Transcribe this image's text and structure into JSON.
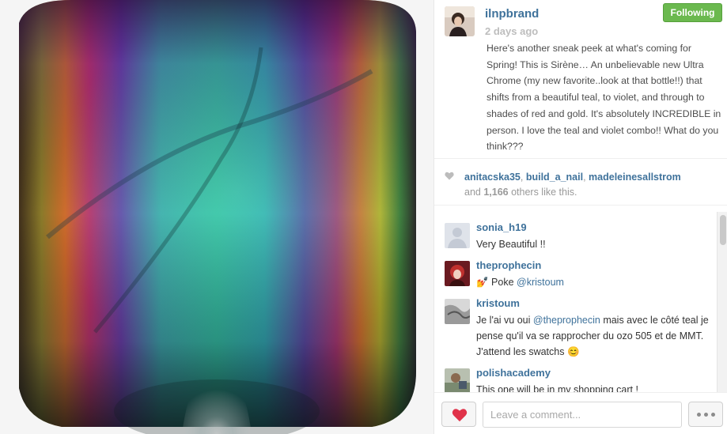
{
  "photo": {
    "subject": "nail polish bottle with multichrome polish",
    "colors": [
      "#2ea5a0",
      "#6a3d9a",
      "#c93a6a",
      "#e8a23a",
      "#2d8f5c"
    ]
  },
  "post": {
    "username": "ilnpbrand",
    "time": "2 days ago",
    "follow_label": "Following",
    "caption": "Here's another sneak peek at what's coming for Spring! This is Sirène… An unbelievable new Ultra Chrome (my new favorite..look at that bottle!!) that shifts from a beautiful teal, to violet, and through to shades of red and gold. It's absolutely INCREDIBLE in person. I love the teal and violet combo!! What do you think???"
  },
  "likes": {
    "users": [
      "anitacska35",
      "build_a_nail",
      "madeleinesallstrom"
    ],
    "sep1": ", ",
    "sep2": ", ",
    "and": "and ",
    "count": "1,166",
    "suffix": " others like this."
  },
  "comments": [
    {
      "user": "sonia_h19",
      "text": "Very Beautiful !!"
    },
    {
      "user": "theprophecin",
      "text": "💅 Poke ",
      "mention": "@kristoum"
    },
    {
      "user": "kristoum",
      "text_before": "Je l'ai vu oui ",
      "mention": "@theprophecin",
      "text_after": " mais avec le côté teal je pense qu'il va se rapprocher du ozo 505 et de MMT. J'attend les swatchs 😊"
    },
    {
      "user": "polishacademy",
      "text": "This one will be in my shopping cart !"
    }
  ],
  "footer": {
    "comment_placeholder": "Leave a comment..."
  },
  "icons": {
    "heart": "heart-icon",
    "more": "more-options-icon"
  },
  "accent": {
    "link": "#3f729b",
    "follow": "#6bb94f",
    "heart": "#e0334a"
  }
}
